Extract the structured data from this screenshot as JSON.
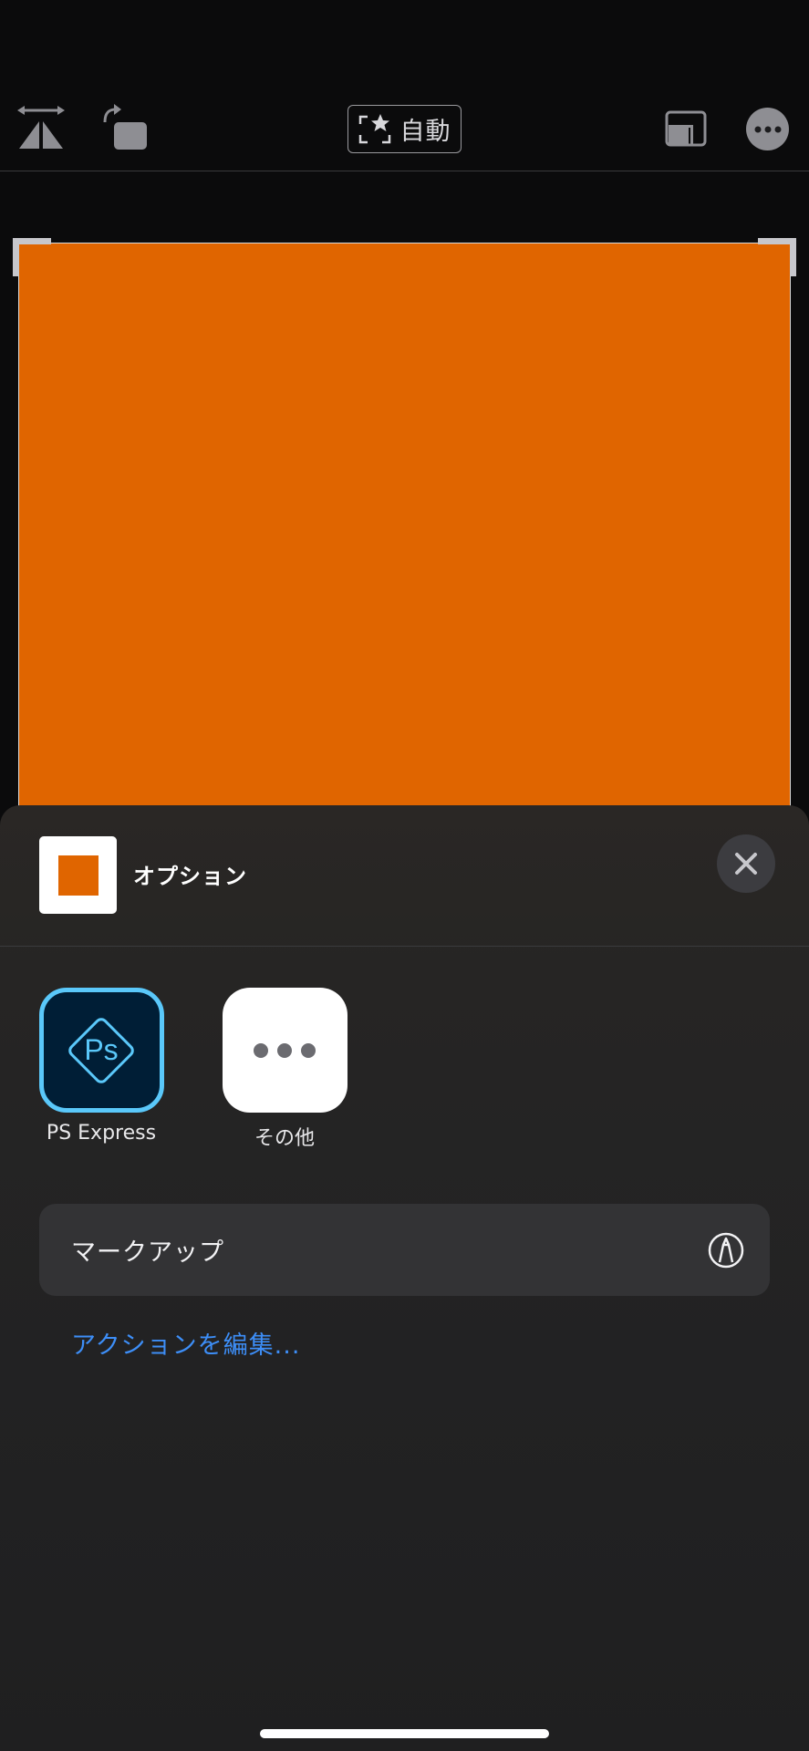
{
  "toolbar": {
    "flip_icon": "flip-horizontal-icon",
    "rotate_icon": "rotate-icon",
    "auto_label": "自動",
    "auto_icon": "auto-crop-star-icon",
    "aspect_icon": "aspect-ratio-icon",
    "more_icon": "ellipsis-icon"
  },
  "canvas": {
    "image_color": "#e06500"
  },
  "share_sheet": {
    "title": "オプション",
    "close_icon": "close-icon",
    "apps": [
      {
        "label": "PS Express",
        "icon": "ps-express-icon"
      },
      {
        "label": "その他",
        "icon": "more-apps-icon"
      }
    ],
    "actions": [
      {
        "label": "マークアップ",
        "icon": "markup-pen-icon"
      }
    ],
    "edit_actions_label": "アクションを編集..."
  },
  "colors": {
    "accent_blue": "#3d8ef7",
    "ps_border": "#5ac8fa",
    "ps_background": "#001e36"
  }
}
